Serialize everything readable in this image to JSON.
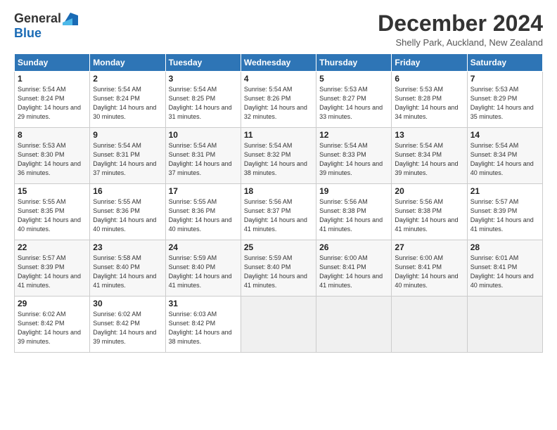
{
  "logo": {
    "general": "General",
    "blue": "Blue"
  },
  "title": "December 2024",
  "location": "Shelly Park, Auckland, New Zealand",
  "days_of_week": [
    "Sunday",
    "Monday",
    "Tuesday",
    "Wednesday",
    "Thursday",
    "Friday",
    "Saturday"
  ],
  "weeks": [
    [
      {
        "day": "1",
        "sunrise": "5:54 AM",
        "sunset": "8:24 PM",
        "daylight": "14 hours and 29 minutes."
      },
      {
        "day": "2",
        "sunrise": "5:54 AM",
        "sunset": "8:24 PM",
        "daylight": "14 hours and 30 minutes."
      },
      {
        "day": "3",
        "sunrise": "5:54 AM",
        "sunset": "8:25 PM",
        "daylight": "14 hours and 31 minutes."
      },
      {
        "day": "4",
        "sunrise": "5:54 AM",
        "sunset": "8:26 PM",
        "daylight": "14 hours and 32 minutes."
      },
      {
        "day": "5",
        "sunrise": "5:53 AM",
        "sunset": "8:27 PM",
        "daylight": "14 hours and 33 minutes."
      },
      {
        "day": "6",
        "sunrise": "5:53 AM",
        "sunset": "8:28 PM",
        "daylight": "14 hours and 34 minutes."
      },
      {
        "day": "7",
        "sunrise": "5:53 AM",
        "sunset": "8:29 PM",
        "daylight": "14 hours and 35 minutes."
      }
    ],
    [
      {
        "day": "8",
        "sunrise": "5:53 AM",
        "sunset": "8:30 PM",
        "daylight": "14 hours and 36 minutes."
      },
      {
        "day": "9",
        "sunrise": "5:54 AM",
        "sunset": "8:31 PM",
        "daylight": "14 hours and 37 minutes."
      },
      {
        "day": "10",
        "sunrise": "5:54 AM",
        "sunset": "8:31 PM",
        "daylight": "14 hours and 37 minutes."
      },
      {
        "day": "11",
        "sunrise": "5:54 AM",
        "sunset": "8:32 PM",
        "daylight": "14 hours and 38 minutes."
      },
      {
        "day": "12",
        "sunrise": "5:54 AM",
        "sunset": "8:33 PM",
        "daylight": "14 hours and 39 minutes."
      },
      {
        "day": "13",
        "sunrise": "5:54 AM",
        "sunset": "8:34 PM",
        "daylight": "14 hours and 39 minutes."
      },
      {
        "day": "14",
        "sunrise": "5:54 AM",
        "sunset": "8:34 PM",
        "daylight": "14 hours and 40 minutes."
      }
    ],
    [
      {
        "day": "15",
        "sunrise": "5:55 AM",
        "sunset": "8:35 PM",
        "daylight": "14 hours and 40 minutes."
      },
      {
        "day": "16",
        "sunrise": "5:55 AM",
        "sunset": "8:36 PM",
        "daylight": "14 hours and 40 minutes."
      },
      {
        "day": "17",
        "sunrise": "5:55 AM",
        "sunset": "8:36 PM",
        "daylight": "14 hours and 40 minutes."
      },
      {
        "day": "18",
        "sunrise": "5:56 AM",
        "sunset": "8:37 PM",
        "daylight": "14 hours and 41 minutes."
      },
      {
        "day": "19",
        "sunrise": "5:56 AM",
        "sunset": "8:38 PM",
        "daylight": "14 hours and 41 minutes."
      },
      {
        "day": "20",
        "sunrise": "5:56 AM",
        "sunset": "8:38 PM",
        "daylight": "14 hours and 41 minutes."
      },
      {
        "day": "21",
        "sunrise": "5:57 AM",
        "sunset": "8:39 PM",
        "daylight": "14 hours and 41 minutes."
      }
    ],
    [
      {
        "day": "22",
        "sunrise": "5:57 AM",
        "sunset": "8:39 PM",
        "daylight": "14 hours and 41 minutes."
      },
      {
        "day": "23",
        "sunrise": "5:58 AM",
        "sunset": "8:40 PM",
        "daylight": "14 hours and 41 minutes."
      },
      {
        "day": "24",
        "sunrise": "5:59 AM",
        "sunset": "8:40 PM",
        "daylight": "14 hours and 41 minutes."
      },
      {
        "day": "25",
        "sunrise": "5:59 AM",
        "sunset": "8:40 PM",
        "daylight": "14 hours and 41 minutes."
      },
      {
        "day": "26",
        "sunrise": "6:00 AM",
        "sunset": "8:41 PM",
        "daylight": "14 hours and 41 minutes."
      },
      {
        "day": "27",
        "sunrise": "6:00 AM",
        "sunset": "8:41 PM",
        "daylight": "14 hours and 40 minutes."
      },
      {
        "day": "28",
        "sunrise": "6:01 AM",
        "sunset": "8:41 PM",
        "daylight": "14 hours and 40 minutes."
      }
    ],
    [
      {
        "day": "29",
        "sunrise": "6:02 AM",
        "sunset": "8:42 PM",
        "daylight": "14 hours and 39 minutes."
      },
      {
        "day": "30",
        "sunrise": "6:02 AM",
        "sunset": "8:42 PM",
        "daylight": "14 hours and 39 minutes."
      },
      {
        "day": "31",
        "sunrise": "6:03 AM",
        "sunset": "8:42 PM",
        "daylight": "14 hours and 38 minutes."
      },
      null,
      null,
      null,
      null
    ]
  ]
}
